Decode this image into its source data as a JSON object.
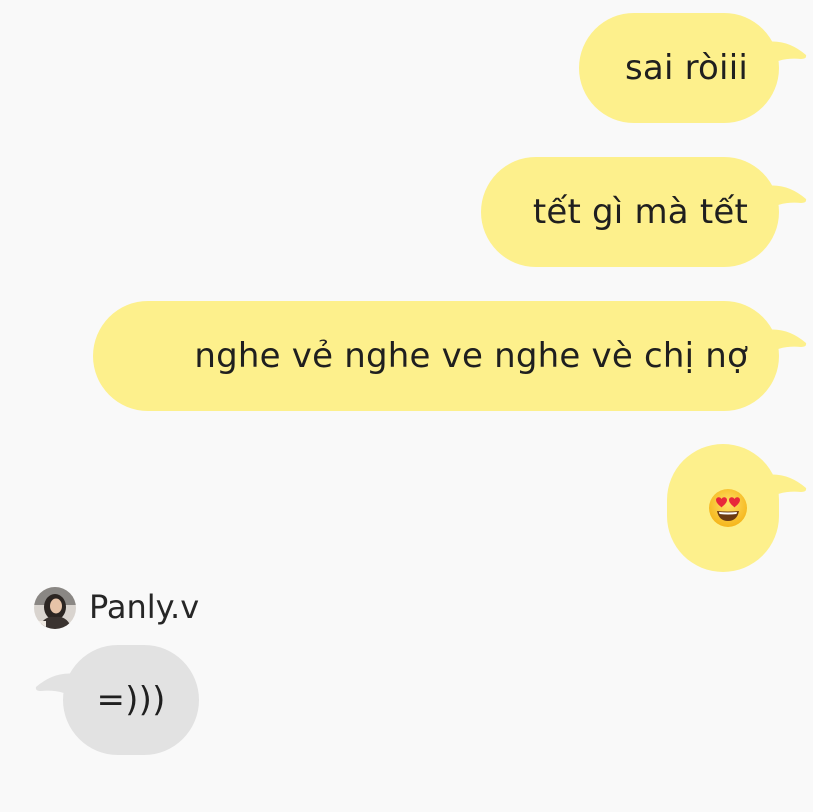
{
  "theme": {
    "outgoing_bubble": "#fdf08c",
    "incoming_bubble": "#e2e2e2",
    "background": "#f9f9f9"
  },
  "messages": [
    {
      "direction": "outgoing",
      "text": "sai ròiii"
    },
    {
      "direction": "outgoing",
      "text": "tết gì mà tết"
    },
    {
      "direction": "outgoing",
      "text": "nghe vẻ nghe ve nghe vè chị nợ"
    },
    {
      "direction": "outgoing",
      "emoji": "heart-eyes-emoji"
    },
    {
      "direction": "incoming",
      "text": "=)))"
    }
  ],
  "sender": {
    "name": "Panly.v",
    "avatar_icon": "profile-photo-avatar"
  }
}
